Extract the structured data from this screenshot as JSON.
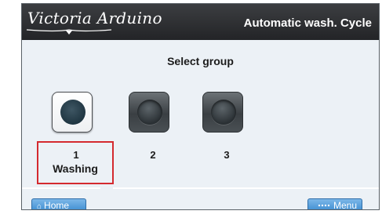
{
  "header": {
    "logo_text": "Victoria Arduino",
    "title": "Automatic wash. Cycle"
  },
  "main": {
    "select_label": "Select group",
    "groups": [
      {
        "number": "1",
        "state": "active",
        "status": "Washing"
      },
      {
        "number": "2",
        "state": "inactive"
      },
      {
        "number": "3",
        "state": "inactive"
      }
    ]
  },
  "footer": {
    "home_label": "Home",
    "menu_label": "Menu"
  },
  "icons": {
    "home": "home-icon",
    "menu": "menu-grid-icon"
  },
  "colors": {
    "header_bg": "#2e3033",
    "screen_bg": "#ecf1f6",
    "highlight": "#d42a2f",
    "button_blue": "#4f9ad9"
  }
}
